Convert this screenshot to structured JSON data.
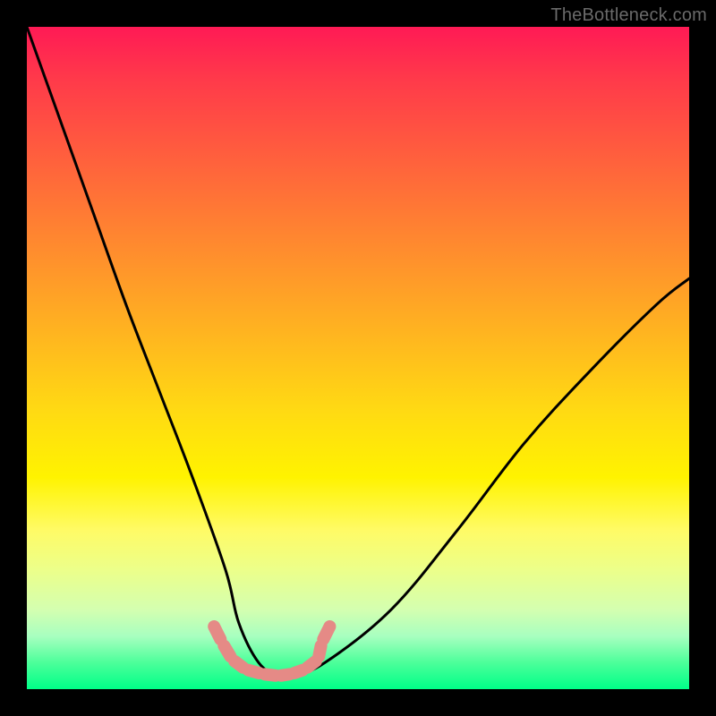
{
  "watermark": "TheBottleneck.com",
  "chart_data": {
    "type": "line",
    "title": "",
    "xlabel": "",
    "ylabel": "",
    "xlim": [
      0,
      100
    ],
    "ylim": [
      0,
      100
    ],
    "grid": false,
    "legend": false,
    "background_gradient": {
      "top": "#ff1a55",
      "mid": "#fff300",
      "bottom": "#00ff88"
    },
    "series": [
      {
        "name": "bottleneck-curve",
        "stroke": "#000000",
        "x": [
          0,
          5,
          10,
          15,
          20,
          25,
          30,
          32,
          35,
          38,
          40,
          45,
          55,
          65,
          75,
          85,
          95,
          100
        ],
        "y": [
          100,
          86,
          72,
          58,
          45,
          32,
          18,
          10,
          4,
          2,
          2,
          4,
          12,
          24,
          37,
          48,
          58,
          62
        ]
      },
      {
        "name": "sample-marks",
        "stroke": "#e58a86",
        "marker": "round-segment",
        "x": [
          28,
          29.5,
          31,
          33,
          35.5,
          38,
          40,
          42,
          44,
          44.5,
          46
        ],
        "y": [
          10,
          7,
          4.5,
          3,
          2.3,
          2,
          2.3,
          3,
          4.5,
          7,
          10
        ]
      }
    ]
  }
}
